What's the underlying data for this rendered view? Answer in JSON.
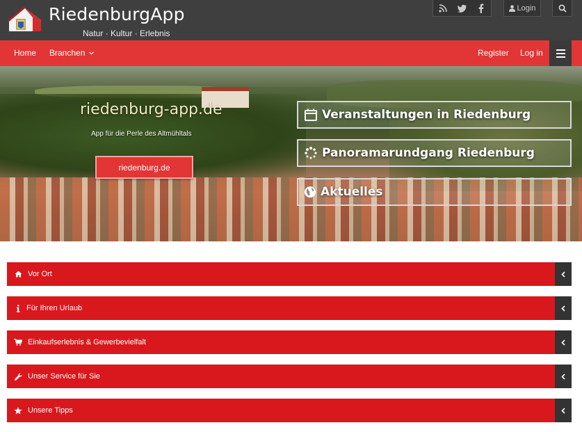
{
  "header": {
    "title": "RiedenburgApp",
    "subtitle": "Natur · Kultur · Erlebnis",
    "login_label": "Login",
    "social_icons": [
      "rss-icon",
      "twitter-icon",
      "facebook-icon"
    ]
  },
  "nav": {
    "home": "Home",
    "branchen": "Branchen",
    "register": "Register",
    "login": "Log in"
  },
  "hero": {
    "title": "riedenburg-app.de",
    "subtitle": "App für die Perle des Altmühltals",
    "button": "riedenburg.de",
    "links": [
      {
        "label": "Veranstaltungen in Riedenburg",
        "icon": "calendar-icon"
      },
      {
        "label": "Panoramarundgang Riedenburg",
        "icon": "spinner-icon"
      },
      {
        "label": "Aktuelles",
        "icon": "globe-icon"
      }
    ]
  },
  "sections": [
    {
      "label": "Vor Ort",
      "icon": "home-icon"
    },
    {
      "label": "Für Ihren Urlaub",
      "icon": "info-icon"
    },
    {
      "label": "Einkaufserlebnis & Gewerbevielfalt",
      "icon": "cart-icon"
    },
    {
      "label": "Unser Service für Sie",
      "icon": "wrench-icon"
    },
    {
      "label": "Unsere Tipps",
      "icon": "star-icon"
    }
  ],
  "colors": {
    "header_bg": "#3f3f3f",
    "accent_red": "#e23535",
    "section_red": "#d9181e",
    "dark": "#333333"
  }
}
